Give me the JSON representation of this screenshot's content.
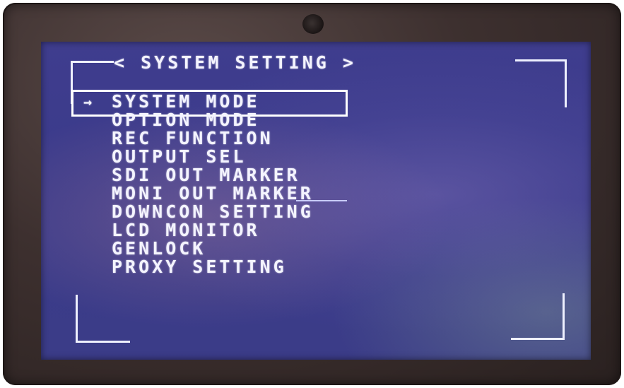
{
  "screen": {
    "title": "< SYSTEM SETTING >",
    "cursor": "→",
    "selected_index": 0,
    "menu_items": [
      "SYSTEM MODE",
      "OPTION MODE",
      "REC FUNCTION",
      "OUTPUT SEL",
      "SDI OUT MARKER",
      "MONI OUT MARKER",
      "DOWNCON SETTING",
      "LCD MONITOR",
      "GENLOCK",
      "PROXY SETTING"
    ]
  },
  "colors": {
    "screen_background": "#3c3c8c",
    "osd_text": "#f4f4ff",
    "bezel": "#3d302f"
  }
}
